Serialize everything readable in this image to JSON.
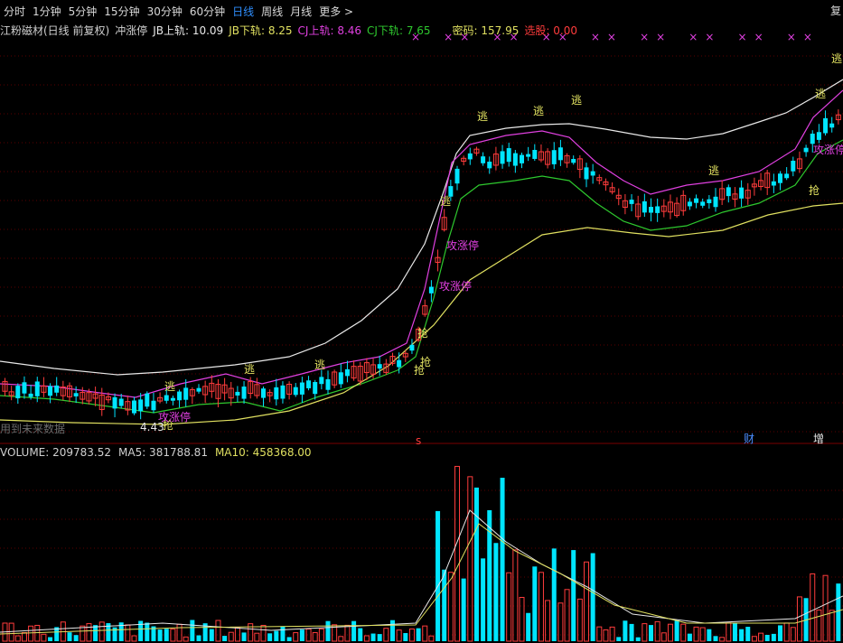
{
  "toolbar": {
    "tabs": [
      {
        "label": "分时",
        "active": false
      },
      {
        "label": "1分钟",
        "active": false
      },
      {
        "label": "5分钟",
        "active": false
      },
      {
        "label": "15分钟",
        "active": false
      },
      {
        "label": "30分钟",
        "active": false
      },
      {
        "label": "60分钟",
        "active": false
      },
      {
        "label": "日线",
        "active": true
      },
      {
        "label": "周线",
        "active": false
      },
      {
        "label": "月线",
        "active": false
      },
      {
        "label": "更多 >",
        "active": false
      }
    ],
    "right_button": "复"
  },
  "legend": {
    "title": "江粉磁材(日线 前复权)",
    "indicator": "冲涨停",
    "jb_upper": "JB上轨: 10.09",
    "jb_lower": "JB下轨: 8.25",
    "cj_upper": "CJ上轨: 8.46",
    "cj_lower": "CJ下轨: 7.65",
    "code": "密码: 157.95",
    "pick": "选股: 0.00"
  },
  "colors": {
    "up": "#ff3c3c",
    "down": "#00e5ff",
    "white": "#e8e8e8",
    "magenta": "#e040e0",
    "green": "#2ec82e",
    "yellow": "#e0e060",
    "tab_active": "#2f8fff"
  },
  "future_note": "用到未来数据",
  "volume_legend": {
    "volume": "VOLUME: 209783.52",
    "ma5": "MA5: 381788.81",
    "ma10": "MA10: 458368.00"
  },
  "chart_data": [
    {
      "type": "candlestick",
      "title": "江粉磁材(日线 前复权)",
      "series_names": [
        "JB上轨",
        "JB下轨",
        "CJ上轨",
        "CJ下轨"
      ],
      "current_values": {
        "JB上轨": 10.09,
        "JB下轨": 8.25,
        "CJ上轨": 8.46,
        "CJ下轨": 7.65
      },
      "price_range_estimate": [
        4.3,
        10.5
      ],
      "min_label": "4.43",
      "annotations": [
        {
          "text": "逃",
          "color": "yellow"
        },
        {
          "text": "抢",
          "color": "yellow"
        },
        {
          "text": "攻涨停",
          "color": "magenta"
        },
        {
          "text": "财",
          "color": "blue"
        },
        {
          "text": "增",
          "color": "white"
        },
        {
          "text": "s",
          "color": "red"
        }
      ]
    },
    {
      "type": "bar",
      "title": "VOLUME",
      "series": [
        {
          "name": "VOLUME",
          "last": 209783.52
        },
        {
          "name": "MA5",
          "last": 381788.81
        },
        {
          "name": "MA10",
          "last": 458368.0
        }
      ]
    }
  ]
}
